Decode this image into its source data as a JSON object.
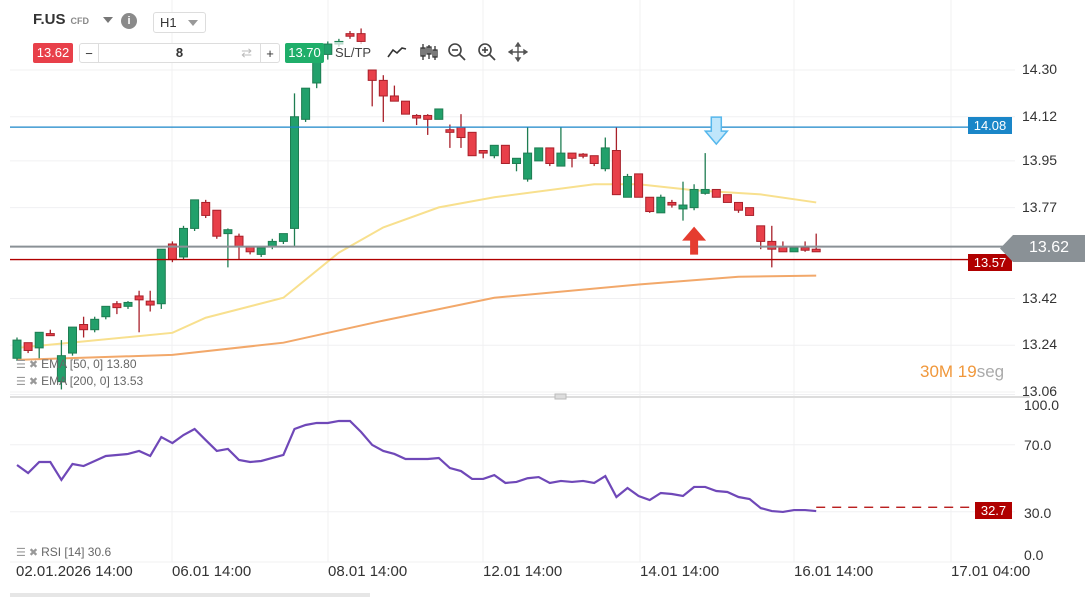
{
  "toolbar": {
    "symbol": "F.US",
    "symbol_type": "CFD",
    "info_icon": "info-icon",
    "timeframe": "H1",
    "sell_price": "13.62",
    "volume": "8",
    "minus": "−",
    "plus": "+",
    "buy_price": "13.70",
    "sltp_label": "SL/TP",
    "tools": [
      "line-chart-icon",
      "candlestick-icon",
      "zoom-out-icon",
      "zoom-in-icon",
      "move-icon"
    ]
  },
  "price_axis": {
    "ticks": [
      "14.30",
      "14.12",
      "13.95",
      "13.77",
      "13.42",
      "13.24",
      "13.06"
    ],
    "tick_values": [
      14.3,
      14.12,
      13.95,
      13.77,
      13.42,
      13.24,
      13.06
    ]
  },
  "levels": {
    "blue_line": {
      "value": 14.08,
      "label": "14.08",
      "color": "#1a86c8"
    },
    "current": {
      "value": 13.62,
      "label": "13.62",
      "color": "#8a9196"
    },
    "red_line": {
      "value": 13.57,
      "label": "13.57",
      "color": "#b00000"
    }
  },
  "timer": {
    "value": "30M 19",
    "unit": "seg"
  },
  "legends": {
    "ema50": "EMA [50, 0] 13.80",
    "ema200": "EMA [200, 0] 13.53",
    "rsi": "RSI [14] 30.6"
  },
  "rsi_axis": {
    "ticks": [
      "100.0",
      "70.0",
      "30.0",
      "0.0"
    ],
    "tick_values": [
      100,
      70,
      30,
      0
    ],
    "current_label": "32.7",
    "current": 32.7
  },
  "time_axis": [
    "02.01.2026 14:00",
    "06.01 14:00",
    "08.01 14:00",
    "12.01 14:00",
    "14.01 14:00",
    "16.01 14:00",
    "17.01 04:00"
  ],
  "colors": {
    "up": "#22a06b",
    "down": "#e8404a",
    "ema50": "#f8e08e",
    "ema200": "#f2a86a",
    "rsi": "#6f48b8"
  },
  "chart_data": {
    "type": "candlestick",
    "candles": [
      [
        13.19,
        13.27,
        13.18,
        13.26
      ],
      [
        13.25,
        13.25,
        13.21,
        13.22
      ],
      [
        13.23,
        13.29,
        13.19,
        13.29
      ],
      [
        13.285,
        13.3,
        13.277,
        13.277
      ],
      [
        13.1,
        13.26,
        13.07,
        13.2
      ],
      [
        13.21,
        13.31,
        13.2,
        13.31
      ],
      [
        13.32,
        13.35,
        13.27,
        13.3
      ],
      [
        13.3,
        13.35,
        13.29,
        13.34
      ],
      [
        13.35,
        13.39,
        13.34,
        13.39
      ],
      [
        13.4,
        13.41,
        13.36,
        13.385
      ],
      [
        13.39,
        13.41,
        13.38,
        13.405
      ],
      [
        13.43,
        13.45,
        13.29,
        13.415
      ],
      [
        13.41,
        13.45,
        13.37,
        13.395
      ],
      [
        13.4,
        13.61,
        13.38,
        13.61
      ],
      [
        13.63,
        13.64,
        13.56,
        13.57
      ],
      [
        13.58,
        13.7,
        13.57,
        13.69
      ],
      [
        13.69,
        13.8,
        13.68,
        13.8
      ],
      [
        13.79,
        13.8,
        13.73,
        13.74
      ],
      [
        13.76,
        13.76,
        13.65,
        13.66
      ],
      [
        13.67,
        13.69,
        13.54,
        13.685
      ],
      [
        13.66,
        13.67,
        13.57,
        13.62
      ],
      [
        13.62,
        13.62,
        13.59,
        13.6
      ],
      [
        13.59,
        13.62,
        13.58,
        13.615
      ],
      [
        13.62,
        13.65,
        13.61,
        13.64
      ],
      [
        13.64,
        13.67,
        13.63,
        13.67
      ],
      [
        13.69,
        14.21,
        13.62,
        14.12
      ],
      [
        14.11,
        14.23,
        14.1,
        14.23
      ],
      [
        14.25,
        14.36,
        14.23,
        14.36
      ],
      [
        14.36,
        14.41,
        14.34,
        14.4
      ],
      [
        14.4,
        14.42,
        14.39,
        14.41
      ],
      [
        14.44,
        14.45,
        14.42,
        14.43
      ],
      [
        14.44,
        14.46,
        14.4,
        14.41
      ],
      [
        14.3,
        14.3,
        14.16,
        14.26
      ],
      [
        14.26,
        14.28,
        14.1,
        14.2
      ],
      [
        14.2,
        14.24,
        14.18,
        14.18
      ],
      [
        14.18,
        14.18,
        14.13,
        14.13
      ],
      [
        14.125,
        14.13,
        14.088,
        14.115
      ],
      [
        14.125,
        14.13,
        14.05,
        14.11
      ],
      [
        14.11,
        14.15,
        14.11,
        14.15
      ],
      [
        14.07,
        14.09,
        14.0,
        14.06
      ],
      [
        14.08,
        14.13,
        14.0,
        14.04
      ],
      [
        14.06,
        14.06,
        13.97,
        13.97
      ],
      [
        13.99,
        13.99,
        13.96,
        13.98
      ],
      [
        13.97,
        14.01,
        13.96,
        14.01
      ],
      [
        14.01,
        14.01,
        13.94,
        13.94
      ],
      [
        13.94,
        13.96,
        13.91,
        13.96
      ],
      [
        13.88,
        14.08,
        13.87,
        13.98
      ],
      [
        13.95,
        14.0,
        13.95,
        14.0
      ],
      [
        14.0,
        14.0,
        13.93,
        13.94
      ],
      [
        13.93,
        14.08,
        13.93,
        13.98
      ],
      [
        13.98,
        13.98,
        13.925,
        13.96
      ],
      [
        13.976,
        13.98,
        13.96,
        13.968
      ],
      [
        13.97,
        13.97,
        13.93,
        13.94
      ],
      [
        13.92,
        14.04,
        13.91,
        14.0
      ],
      [
        13.99,
        14.08,
        13.82,
        13.82
      ],
      [
        13.81,
        13.9,
        13.81,
        13.89
      ],
      [
        13.9,
        13.9,
        13.81,
        13.81
      ],
      [
        13.81,
        13.81,
        13.75,
        13.755
      ],
      [
        13.75,
        13.82,
        13.75,
        13.81
      ],
      [
        13.79,
        13.8,
        13.77,
        13.78
      ],
      [
        13.765,
        13.87,
        13.72,
        13.78
      ],
      [
        13.77,
        13.86,
        13.76,
        13.84
      ],
      [
        13.825,
        13.98,
        13.82,
        13.84
      ],
      [
        13.84,
        13.84,
        13.81,
        13.81
      ],
      [
        13.82,
        13.82,
        13.79,
        13.79
      ],
      [
        13.79,
        13.79,
        13.75,
        13.76
      ],
      [
        13.77,
        13.77,
        13.74,
        13.74
      ],
      [
        13.7,
        13.7,
        13.61,
        13.64
      ],
      [
        13.64,
        13.7,
        13.54,
        13.61
      ],
      [
        13.62,
        13.64,
        13.6,
        13.6
      ],
      [
        13.6,
        13.62,
        13.6,
        13.616
      ],
      [
        13.616,
        13.64,
        13.6,
        13.606
      ],
      [
        13.61,
        13.67,
        13.6,
        13.6
      ]
    ],
    "candle_format": [
      "open",
      "high",
      "low",
      "close"
    ],
    "ema50": [
      [
        0,
        13.23
      ],
      [
        14,
        13.288
      ],
      [
        17,
        13.346
      ],
      [
        24,
        13.423
      ],
      [
        29,
        13.597
      ],
      [
        33,
        13.694
      ],
      [
        38,
        13.771
      ],
      [
        43,
        13.81
      ],
      [
        52,
        13.86
      ],
      [
        56,
        13.86
      ],
      [
        61,
        13.837
      ],
      [
        67,
        13.821
      ],
      [
        72,
        13.79
      ]
    ],
    "ema200": [
      [
        0,
        13.184
      ],
      [
        14,
        13.203
      ],
      [
        24,
        13.25
      ],
      [
        33,
        13.335
      ],
      [
        43,
        13.423
      ],
      [
        56,
        13.474
      ],
      [
        65,
        13.504
      ],
      [
        72,
        13.508
      ]
    ],
    "rsi": [
      57.9,
      53.1,
      59.7,
      59.7,
      49.0,
      58.5,
      57.3,
      60.3,
      63.3,
      63.9,
      64.5,
      66.3,
      63.3,
      74.6,
      71.0,
      75.8,
      79.4,
      72.8,
      66.3,
      67.5,
      60.9,
      59.7,
      60.3,
      62.1,
      63.9,
      79.4,
      81.8,
      83.0,
      83.0,
      84.2,
      84.2,
      77.6,
      69.9,
      66.3,
      64.5,
      61.5,
      61.5,
      61.5,
      62.1,
      56.1,
      54.3,
      49.6,
      49.6,
      51.9,
      47.2,
      47.8,
      50.0,
      50.7,
      47.2,
      48.4,
      47.8,
      48.4,
      47.2,
      51.3,
      38.8,
      44.2,
      39.4,
      37.0,
      41.2,
      40.6,
      39.4,
      44.8,
      44.8,
      42.4,
      41.8,
      38.8,
      37.6,
      32.2,
      30.4,
      29.9,
      31.0,
      31.0,
      30.4
    ],
    "signals": [
      {
        "type": "sell-arrow",
        "candle": 63,
        "price": 14.08
      },
      {
        "type": "buy-arrow",
        "candle": 61,
        "price": 13.62
      }
    ]
  }
}
